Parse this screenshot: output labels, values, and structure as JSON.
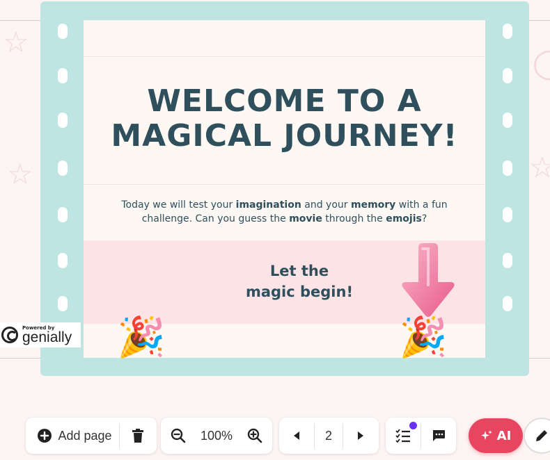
{
  "slide": {
    "title_line1": "WELCOME TO A",
    "title_line2": "MAGICAL JOURNEY!",
    "intro_parts": {
      "p1": "Today we will test your ",
      "b1": "imagination",
      "p2": " and your ",
      "b2": "memory",
      "p3": " with a fun challenge. Can you guess the ",
      "b3": "movie",
      "p4": " through the ",
      "b4": "emojis",
      "p5": "?"
    },
    "cta_line1": "Let the",
    "cta_line2": "magic begin!",
    "popper_emoji": "🎉"
  },
  "badge": {
    "powered_by": "Powered by",
    "brand": "genially"
  },
  "toolbar": {
    "add_page_label": "Add page",
    "zoom_value": "100%",
    "page_number": "2",
    "ai_label": "AI"
  },
  "colors": {
    "film": "#bfe5e3",
    "title": "#2f4f5c",
    "pink_band": "#fbe3e6",
    "ai_button": "#e84561",
    "notification_dot": "#6b2ff5"
  },
  "icons": [
    "add-circle-icon",
    "trash-icon",
    "zoom-out-icon",
    "zoom-in-icon",
    "prev-page-icon",
    "next-page-icon",
    "checklist-icon",
    "comment-icon",
    "sparkle-icon",
    "pencil-icon",
    "arrow-down-icon",
    "party-popper-icon",
    "genially-logo-icon"
  ]
}
